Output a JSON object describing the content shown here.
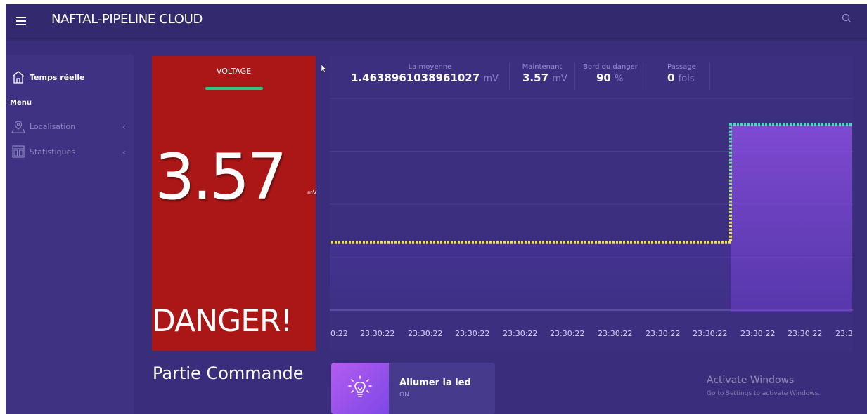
{
  "header": {
    "title": "NAFTAL-PIPELINE CLOUD",
    "menu_icon": "hamburger-menu-icon",
    "search_icon": "search-icon"
  },
  "sidebar": {
    "active_item": {
      "label": "Temps réelle",
      "icon": "home-icon"
    },
    "heading": "Menu",
    "items": [
      {
        "label": "Localisation",
        "icon": "map-location-icon"
      },
      {
        "label": "Statistiques",
        "icon": "columns-icon"
      }
    ]
  },
  "voltage_card": {
    "title": "VOLTAGE",
    "value": "3.57",
    "unit": "mV",
    "status": "DANGER!",
    "background_color": "#ab1717",
    "indicator_color": "#23c985"
  },
  "stats": [
    {
      "label": "La moyenne",
      "value": "1.4638961038961027",
      "unit": "mV"
    },
    {
      "label": "Maintenant",
      "value": "3.57",
      "unit": "mV"
    },
    {
      "label": "Bord du danger",
      "value": "90",
      "unit": "%"
    },
    {
      "label": "Passage",
      "value": "0",
      "unit": "fois"
    }
  ],
  "chart_data": {
    "type": "line",
    "x": [
      "23:30:22",
      "23:30:22",
      "23:30:22",
      "23:30:22",
      "23:30:22",
      "23:30:22",
      "23:30:22",
      "23:30:22",
      "23:30:22",
      "23:30:22",
      "23:30:22",
      "23:30:22"
    ],
    "x_tick_labels": [
      "0:22",
      "23:30:22",
      "23:30:22",
      "23:30:22",
      "23:30:22",
      "23:30:22",
      "23:30:22",
      "23:30:22",
      "23:30:22",
      "23:30:22",
      "23:30:22",
      "23:3"
    ],
    "series": [
      {
        "values": [
          1.3,
          1.3,
          1.3,
          1.3,
          1.3,
          1.3,
          1.3,
          1.3,
          1.3,
          3.57,
          3.57,
          3.57
        ]
      }
    ],
    "ylim": [
      0,
      4
    ],
    "step_after_index": 8,
    "grid": true,
    "line_colors": [
      "#f5e63a",
      "#3fe0b8"
    ],
    "fill_color": "#7a48d8"
  },
  "control": {
    "section_title": "Partie Commande",
    "led_label": "Allumer la led",
    "led_state": "ON",
    "led_icon": "lightbulb-icon"
  },
  "watermark": {
    "title": "Activate Windows",
    "subtitle": "Go to Settings to activate Windows."
  }
}
